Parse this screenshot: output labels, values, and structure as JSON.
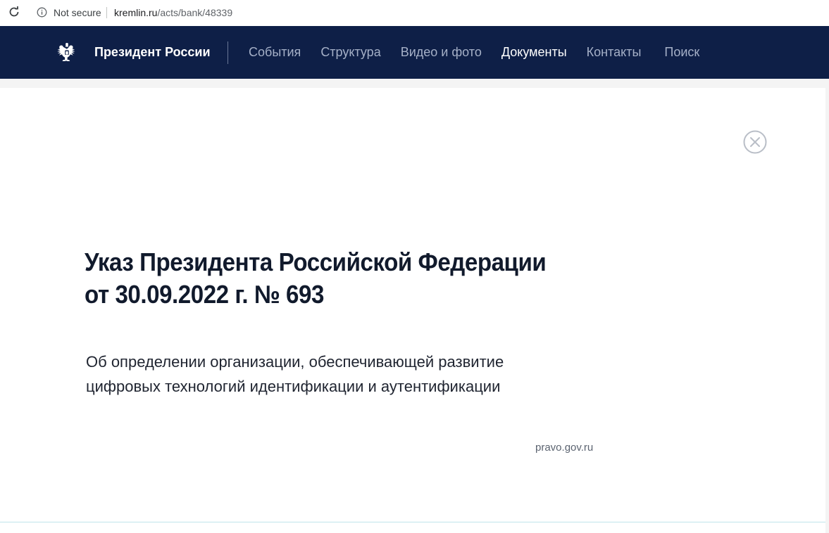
{
  "browser": {
    "security_label": "Not secure",
    "url_host": "kremlin.ru",
    "url_path": "/acts/bank/48339"
  },
  "header": {
    "site_title": "Президент России",
    "nav": [
      {
        "label": "События",
        "active": false
      },
      {
        "label": "Структура",
        "active": false
      },
      {
        "label": "Видео и фото",
        "active": false
      },
      {
        "label": "Документы",
        "active": true
      },
      {
        "label": "Контакты",
        "active": false
      },
      {
        "label": "Поиск",
        "active": false
      }
    ]
  },
  "document": {
    "title_line1": "Указ Президента Российской Федерации",
    "title_line2": "от 30.09.2022 г. № 693",
    "subtitle_line1": "Об определении организации, обеспечивающей развитие",
    "subtitle_line2": "цифровых технологий идентификации и аутентификации",
    "source": "pravo.gov.ru"
  },
  "colors": {
    "header_bg": "#0e1f47",
    "nav_inactive": "#a5b0c7",
    "nav_active": "#ffffff",
    "title_text": "#111a2c"
  },
  "icons": {
    "reload": "reload-icon",
    "info": "info-icon",
    "emblem": "double-headed-eagle-emblem",
    "close": "close-circle-icon"
  }
}
